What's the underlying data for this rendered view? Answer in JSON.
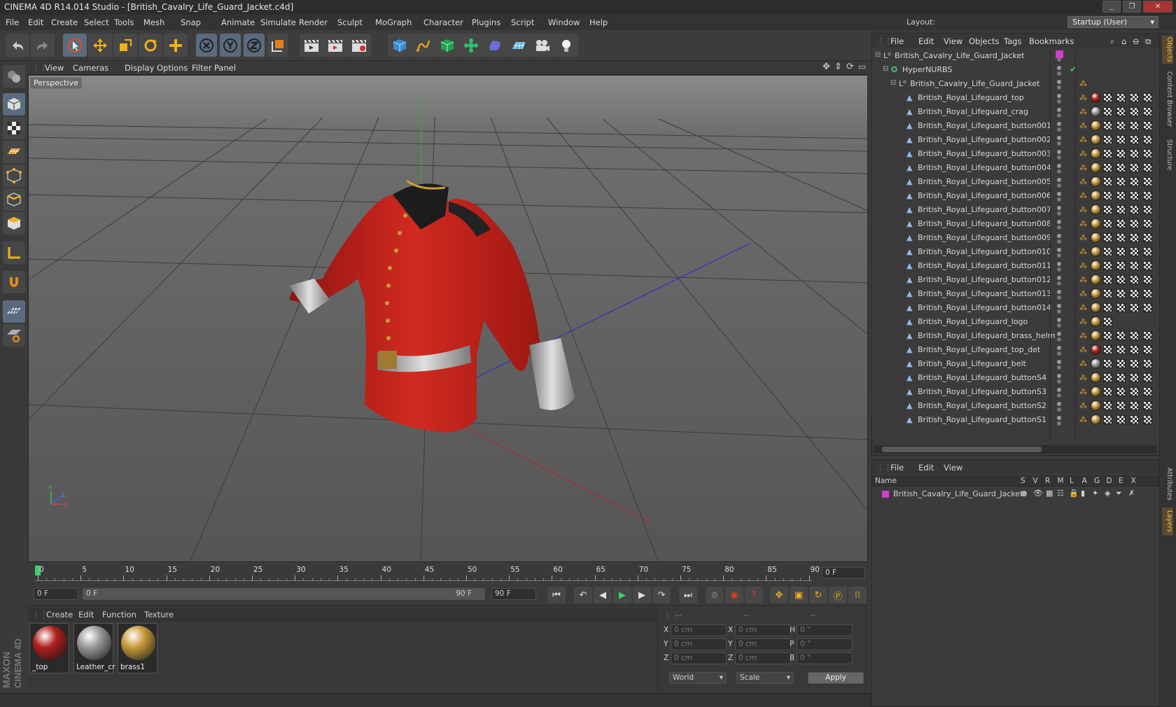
{
  "window": {
    "title": "CINEMA 4D R14.014 Studio - [British_Cavalry_Life_Guard_Jacket.c4d]"
  },
  "menu": [
    "File",
    "Edit",
    "Create",
    "Select",
    "Tools",
    "Mesh",
    "Snap",
    "Animate",
    "Simulate",
    "Render",
    "Sculpt",
    "MoGraph",
    "Character",
    "Plugins",
    "Script",
    "Window",
    "Help"
  ],
  "layout": {
    "label": "Layout:",
    "value": "Startup (User)"
  },
  "viewport": {
    "menu": [
      "View",
      "Cameras",
      "Display",
      "Options",
      "Filter",
      "Panel"
    ],
    "label": "Perspective",
    "axis_y": "Y",
    "axis_x": "X",
    "axis_z": "Z"
  },
  "timeline": {
    "ticks": [
      "0",
      "5",
      "10",
      "15",
      "20",
      "25",
      "30",
      "35",
      "40",
      "45",
      "50",
      "55",
      "60",
      "65",
      "70",
      "75",
      "80",
      "85",
      "90"
    ],
    "current_frame": "0 F",
    "start_field": "0 F",
    "range_start": "0 F",
    "range_end": "90 F",
    "end_field": "90 F"
  },
  "materials": {
    "menu": [
      "Create",
      "Edit",
      "Function",
      "Texture"
    ],
    "items": [
      {
        "name": "_top",
        "color": "#b0201c"
      },
      {
        "name": "Leather_cr",
        "color": "#9a9a9a"
      },
      {
        "name": "brass1",
        "color": "#c89a3a"
      }
    ]
  },
  "coords": {
    "headers": [
      "--",
      "--",
      "--"
    ],
    "rows": [
      {
        "a": "X",
        "av": "0 cm",
        "b": "X",
        "bv": "0 cm",
        "c": "H",
        "cv": "0 °"
      },
      {
        "a": "Y",
        "av": "0 cm",
        "b": "Y",
        "bv": "0 cm",
        "c": "P",
        "cv": "0 °"
      },
      {
        "a": "Z",
        "av": "0 cm",
        "b": "Z",
        "bv": "0 cm",
        "c": "B",
        "cv": "0 °"
      }
    ],
    "world": "World",
    "scale": "Scale",
    "apply": "Apply"
  },
  "objects": {
    "menu": [
      "File",
      "Edit",
      "View",
      "Objects",
      "Tags",
      "Bookmarks"
    ],
    "tree": [
      {
        "name": "British_Cavalry_Life_Guard_Jacket",
        "level": 0,
        "kind": "null"
      },
      {
        "name": "HyperNURBS",
        "level": 1,
        "kind": "nurbs"
      },
      {
        "name": "British_Cavalry_Life_Guard_Jacket",
        "level": 2,
        "kind": "null"
      },
      {
        "name": "British_Royal_Lifeguard_top",
        "level": 3,
        "kind": "mesh",
        "mat": "#b0201c"
      },
      {
        "name": "British_Royal_Lifeguard_crag",
        "level": 3,
        "kind": "mesh",
        "mat": "#9a9a9a"
      },
      {
        "name": "British_Royal_Lifeguard_button001",
        "level": 3,
        "kind": "mesh",
        "mat": "#c89a3a"
      },
      {
        "name": "British_Royal_Lifeguard_button002",
        "level": 3,
        "kind": "mesh",
        "mat": "#c89a3a"
      },
      {
        "name": "British_Royal_Lifeguard_button003",
        "level": 3,
        "kind": "mesh",
        "mat": "#c89a3a"
      },
      {
        "name": "British_Royal_Lifeguard_button004",
        "level": 3,
        "kind": "mesh",
        "mat": "#c89a3a"
      },
      {
        "name": "British_Royal_Lifeguard_button005",
        "level": 3,
        "kind": "mesh",
        "mat": "#c89a3a"
      },
      {
        "name": "British_Royal_Lifeguard_button006",
        "level": 3,
        "kind": "mesh",
        "mat": "#c89a3a"
      },
      {
        "name": "British_Royal_Lifeguard_button007",
        "level": 3,
        "kind": "mesh",
        "mat": "#c89a3a"
      },
      {
        "name": "British_Royal_Lifeguard_button008",
        "level": 3,
        "kind": "mesh",
        "mat": "#c89a3a"
      },
      {
        "name": "British_Royal_Lifeguard_button009",
        "level": 3,
        "kind": "mesh",
        "mat": "#c89a3a"
      },
      {
        "name": "British_Royal_Lifeguard_button010",
        "level": 3,
        "kind": "mesh",
        "mat": "#c89a3a"
      },
      {
        "name": "British_Royal_Lifeguard_button011",
        "level": 3,
        "kind": "mesh",
        "mat": "#c89a3a"
      },
      {
        "name": "British_Royal_Lifeguard_button012",
        "level": 3,
        "kind": "mesh",
        "mat": "#c89a3a"
      },
      {
        "name": "British_Royal_Lifeguard_button013",
        "level": 3,
        "kind": "mesh",
        "mat": "#c89a3a"
      },
      {
        "name": "British_Royal_Lifeguard_button014",
        "level": 3,
        "kind": "mesh",
        "mat": "#c89a3a"
      },
      {
        "name": "British_Royal_Lifeguard_logo",
        "level": 3,
        "kind": "mesh",
        "mat": "#c89a3a"
      },
      {
        "name": "British_Royal_Lifeguard_brass_helm",
        "level": 3,
        "kind": "mesh",
        "mat": "#c89a3a"
      },
      {
        "name": "British_Royal_Lifeguard_top_det",
        "level": 3,
        "kind": "mesh",
        "mat": "#b0201c"
      },
      {
        "name": "British_Royal_Lifeguard_belt",
        "level": 3,
        "kind": "mesh",
        "mat": "#9a9a9a"
      },
      {
        "name": "British_Royal_Lifeguard_buttonS4",
        "level": 3,
        "kind": "mesh",
        "mat": "#c89a3a"
      },
      {
        "name": "British_Royal_Lifeguard_buttonS3",
        "level": 3,
        "kind": "mesh",
        "mat": "#c89a3a"
      },
      {
        "name": "British_Royal_Lifeguard_buttonS2",
        "level": 3,
        "kind": "mesh",
        "mat": "#c89a3a"
      },
      {
        "name": "British_Royal_Lifeguard_buttonS1",
        "level": 3,
        "kind": "mesh",
        "mat": "#c89a3a"
      }
    ]
  },
  "layers": {
    "menu": [
      "File",
      "Edit",
      "View"
    ],
    "columns": [
      "Name",
      "S",
      "V",
      "R",
      "M",
      "L",
      "A",
      "G",
      "D",
      "E",
      "X"
    ],
    "row": {
      "name": "British_Cavalry_Life_Guard_Jacket",
      "color": "#d040d0"
    }
  },
  "side_tabs": [
    "Objects",
    "Content Browser",
    "Structure",
    "Attributes",
    "Layers"
  ],
  "brand": {
    "line1": "MAXON",
    "line2": "CINEMA 4D"
  },
  "colors": {
    "accent": "#5b6b7f",
    "selected": "#6d7c8f",
    "jacket": "#c8261e"
  }
}
